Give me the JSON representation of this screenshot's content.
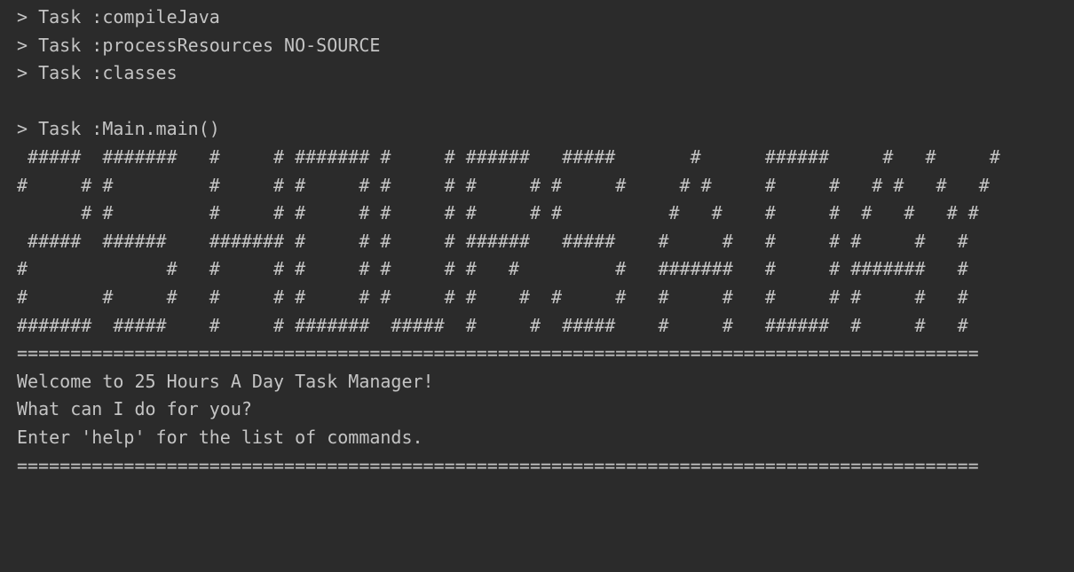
{
  "console": {
    "lines": [
      "> Task :compileJava",
      "> Task :processResources NO-SOURCE",
      "> Task :classes",
      "",
      "> Task :Main.main()",
      " #####  #######   #     # ####### #     # ######   #####       #      ######     #   #     #",
      "#     # #         #     # #     # #     # #     # #     #     # #     #     #   # #   #   #",
      "      # #         #     # #     # #     # #     # #          #   #    #     #  #   #   # #",
      " #####  ######    ####### #     # #     # ######   #####    #     #   #     # #     #   #",
      "#             #   #     # #     # #     # #   #         #   #######   #     # #######   #",
      "#       #     #   #     # #     # #     # #    #  #     #   #     #   #     # #     #   #",
      "#######  #####    #     # #######  #####  #     #  #####    #     #   ######  #     #   #",
      "==========================================================================================",
      "Welcome to 25 Hours A Day Task Manager!",
      "What can I do for you?",
      "Enter 'help' for the list of commands.",
      "=========================================================================================="
    ]
  }
}
